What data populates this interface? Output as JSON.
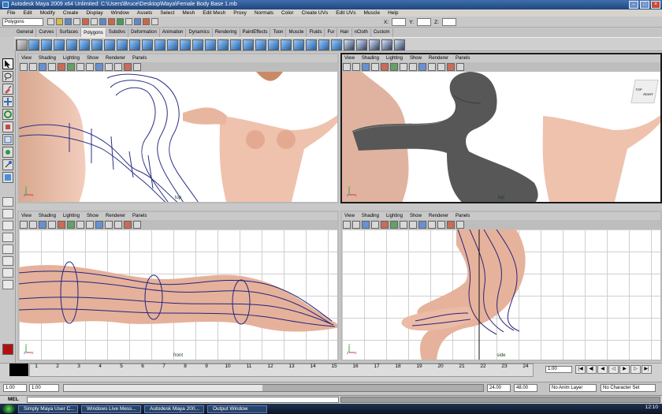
{
  "app": {
    "title": "Autodesk Maya 2009 x64 Unlimited: C:\\Users\\Bruce\\Desktop\\Maya\\Female Body Base 1.mb",
    "window_controls": [
      "–",
      "□",
      "×"
    ]
  },
  "menu": [
    "File",
    "Edit",
    "Modify",
    "Create",
    "Display",
    "Window",
    "Assets",
    "Select",
    "Mesh",
    "Edit Mesh",
    "Proxy",
    "Normals",
    "Color",
    "Create UVs",
    "Edit UVs",
    "Muscle",
    "Help"
  ],
  "status": {
    "mode": "Polygons",
    "x_label": "X:",
    "y_label": "Y:",
    "z_label": "Z:"
  },
  "shelf_tabs": [
    "General",
    "Curves",
    "Surfaces",
    "Polygons",
    "Subdivs",
    "Deformation",
    "Animation",
    "Dynamics",
    "Rendering",
    "PaintEffects",
    "Toon",
    "Muscle",
    "Fluids",
    "Fur",
    "Hair",
    "nCloth",
    "Custom"
  ],
  "shelf_active": "Polygons",
  "viewport_menu": [
    "View",
    "Shading",
    "Lighting",
    "Show",
    "Renderer",
    "Panels"
  ],
  "viewports": [
    {
      "label": "top",
      "axis_labels": [
        "y",
        "z",
        "x"
      ]
    },
    {
      "label": "top",
      "axis_labels": [
        "y",
        "z",
        "x"
      ]
    },
    {
      "label": "front",
      "axis_labels": [
        "y",
        "z",
        "x"
      ]
    },
    {
      "label": "side",
      "axis_labels": [
        "y",
        "z",
        "x"
      ]
    }
  ],
  "timeline": {
    "ticks": [
      "1",
      "2",
      "3",
      "4",
      "5",
      "6",
      "7",
      "8",
      "9",
      "10",
      "11",
      "12",
      "13",
      "14",
      "15",
      "16",
      "17",
      "18",
      "19",
      "20",
      "21",
      "22",
      "23",
      "24"
    ],
    "current_time": "1.00",
    "start_time": "1.00",
    "range_start": "1.00",
    "range_end": "24.00",
    "end_time": "48.00",
    "anim_layer": "No Anim Layer",
    "character_set": "No Character Set"
  },
  "command_line": {
    "label": "MEL"
  },
  "taskbar": {
    "items": [
      "Simply Maya User C...",
      "Windows Live Mess...",
      "Autodesk Maya 200...",
      "Output Window"
    ],
    "clock": "12:10"
  },
  "view_cube": {
    "top": "TOP",
    "right": "RIGHT"
  }
}
